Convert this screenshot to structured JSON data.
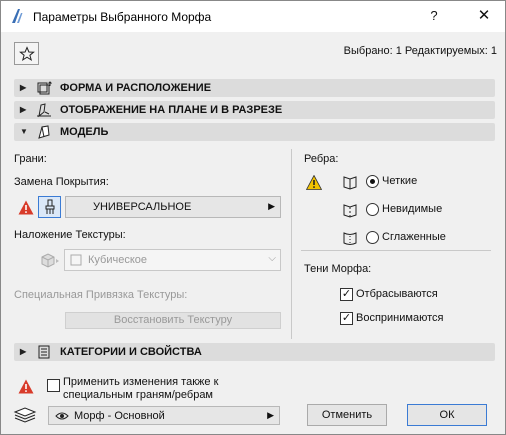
{
  "window": {
    "title": "Параметры Выбранного Морфа",
    "help": "?",
    "close": "✕"
  },
  "selection": {
    "info": "Выбрано: 1 Редактируемых: 1"
  },
  "panels": [
    {
      "label": "ФОРМА И РАСПОЛОЖЕНИЕ",
      "state": "collapsed"
    },
    {
      "label": "ОТОБРАЖЕНИЕ НА ПЛАНЕ И В РАЗРЕЗЕ",
      "state": "collapsed"
    },
    {
      "label": "МОДЕЛЬ",
      "state": "expanded"
    },
    {
      "label": "КАТЕГОРИИ И СВОЙСТВА",
      "state": "collapsed"
    }
  ],
  "model": {
    "faces_label": "Грани:",
    "surface_override_label": "Замена Покрытия:",
    "surface_value": "УНИВЕРСАЛЬНОЕ",
    "texture_label": "Наложение Текстуры:",
    "texture_value": "Кубическое",
    "special_texture_label": "Специальная Привязка Текстуры:",
    "restore_texture_button": "Восстановить Текстуру",
    "edges_label": "Ребра:",
    "edges_options": [
      "Четкие",
      "Невидимые",
      "Сглаженные"
    ],
    "edges_selected": "Четкие",
    "shadows_label": "Тени Морфа:",
    "cast_shadows": {
      "label": "Отбрасываются",
      "checked": true
    },
    "receive_shadows": {
      "label": "Воспринимаются",
      "checked": true
    }
  },
  "footer": {
    "apply_special_label_line1": "Применить изменения также к",
    "apply_special_label_line2": "специальным граням/ребрам",
    "apply_special_checked": false,
    "layer_value": "Морф - Основной",
    "cancel_button": "Отменить",
    "ok_button": "ОК"
  },
  "colors": {
    "accent": "#3b7bd4",
    "warning": "#d83b2a",
    "warning_yellow": "#f2c200",
    "header_bg": "#dcdcdc"
  }
}
